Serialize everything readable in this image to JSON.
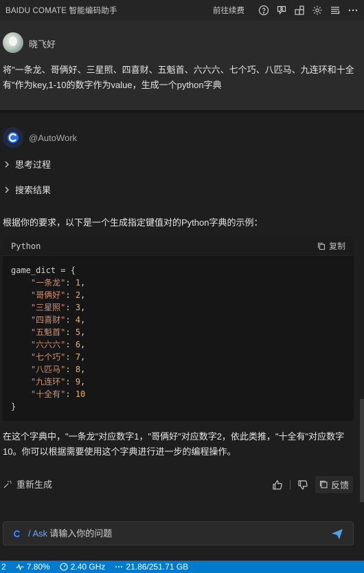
{
  "titlebar": {
    "title": "BAIDU COMATE 智能编码助手",
    "renew_label": "前往续费",
    "icons": [
      "help-icon",
      "feedback-person-icon",
      "layout-icon",
      "gear-icon",
      "list-icon",
      "more-icon"
    ]
  },
  "user": {
    "name": "晓飞好",
    "message": "将\"一条龙、哥俩好、三星照、四喜财、五魁首、六六六、七个巧、八匹马、九连环和十全有\"作为key,1-10的数字作为value，生成一个python字典"
  },
  "bot": {
    "name": "@AutoWork",
    "collapsibles": [
      "思考过程",
      "搜索结果"
    ],
    "intro": "根据你的要求，以下是一个生成指定键值对的Python字典的示例：",
    "code": {
      "language": "Python",
      "copy_label": "复制",
      "var_open": "game_dict = {",
      "entries": [
        {
          "key": "\"一条龙\"",
          "value": "1"
        },
        {
          "key": "\"哥俩好\"",
          "value": "2"
        },
        {
          "key": "\"三星照\"",
          "value": "3"
        },
        {
          "key": "\"四喜财\"",
          "value": "4"
        },
        {
          "key": "\"五魁首\"",
          "value": "5"
        },
        {
          "key": "\"六六六\"",
          "value": "6"
        },
        {
          "key": "\"七个巧\"",
          "value": "7"
        },
        {
          "key": "\"八匹马\"",
          "value": "8"
        },
        {
          "key": "\"九连环\"",
          "value": "9"
        },
        {
          "key": "\"十全有\"",
          "value": "10"
        }
      ],
      "close": "}"
    },
    "outro": "在这个字典中，\"一条龙\"对应数字1，\"哥俩好\"对应数字2，依此类推，\"十全有\"对应数字10。你可以根据需要使用这个字典进行进一步的编程操作。",
    "regenerate_label": "重新生成",
    "feedback_label": "反馈"
  },
  "input": {
    "ask_label": "/ Ask",
    "placeholder": "请输入你的问题"
  },
  "statusbar": {
    "left_fragment": "2",
    "cpu": "7.80%",
    "freq": "2.40 GHz",
    "memory": "21.86/251.71 GB"
  },
  "colors": {
    "accent": "#007acc",
    "string": "#ce9178",
    "number": "#e5b567",
    "ask": "#6aa5ff"
  }
}
